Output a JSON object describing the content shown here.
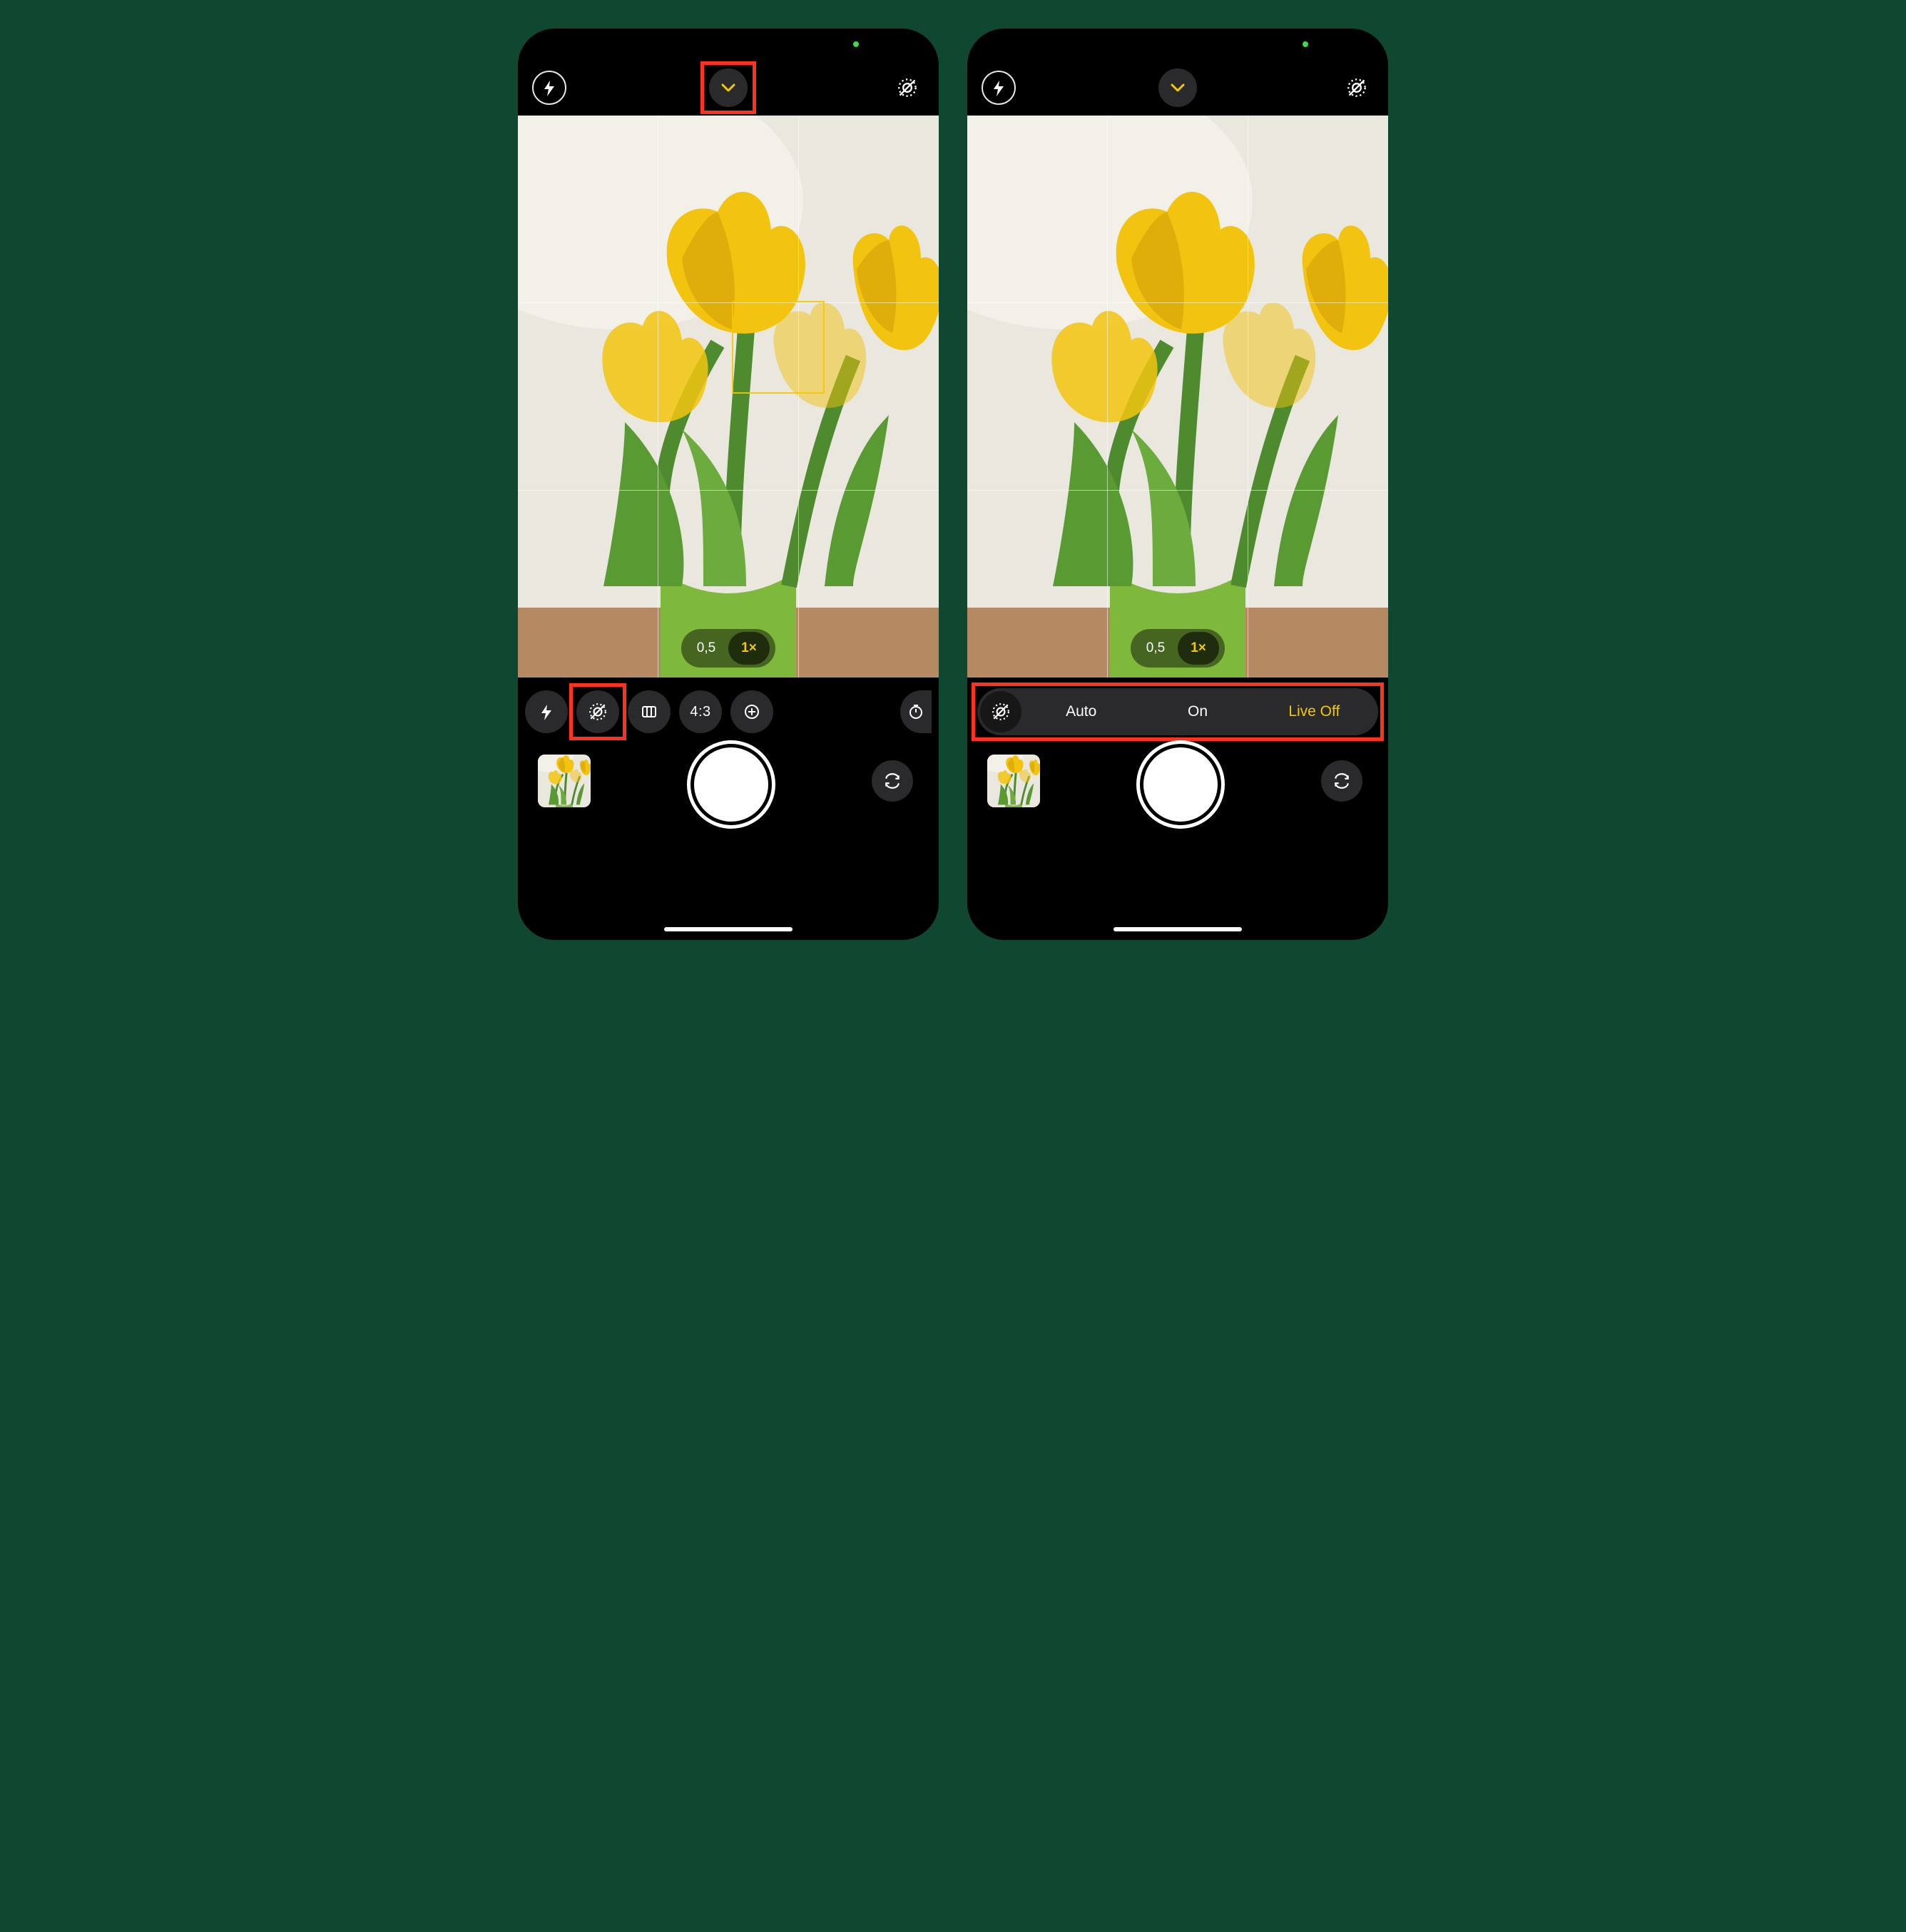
{
  "left": {
    "topbar": {
      "flash_icon": "flash-icon",
      "chevron_icon": "chevron-down-icon",
      "live_photo_icon": "live-photo-off-icon"
    },
    "zoom": {
      "options": [
        {
          "label": "0,5",
          "active": false
        },
        {
          "label": "1×",
          "active": true
        }
      ]
    },
    "tooltray": {
      "items": [
        {
          "name": "flash-button",
          "icon": "flash-icon",
          "text": ""
        },
        {
          "name": "live-photo-button",
          "icon": "live-photo-off-icon",
          "text": "",
          "highlighted": true
        },
        {
          "name": "photographic-styles-button",
          "icon": "styles-icon",
          "text": ""
        },
        {
          "name": "aspect-ratio-button",
          "icon": "",
          "text": "4:3"
        },
        {
          "name": "exposure-button",
          "icon": "exposure-icon",
          "text": ""
        },
        {
          "name": "timer-button",
          "icon": "timer-icon",
          "text": ""
        }
      ]
    }
  },
  "right": {
    "topbar": {
      "flash_icon": "flash-icon",
      "chevron_icon": "chevron-down-icon",
      "live_photo_icon": "live-photo-off-icon"
    },
    "zoom": {
      "options": [
        {
          "label": "0,5",
          "active": false
        },
        {
          "label": "1×",
          "active": true
        }
      ]
    },
    "livebar": {
      "icon": "live-photo-off-icon",
      "options": [
        {
          "label": "Auto",
          "active": false
        },
        {
          "label": "On",
          "active": false
        },
        {
          "label": "Live Off",
          "active": true
        }
      ]
    }
  },
  "shared": {
    "shutter": "shutter-button",
    "flip": "camera-flip-button",
    "thumbnail": "last-photo-thumbnail"
  }
}
